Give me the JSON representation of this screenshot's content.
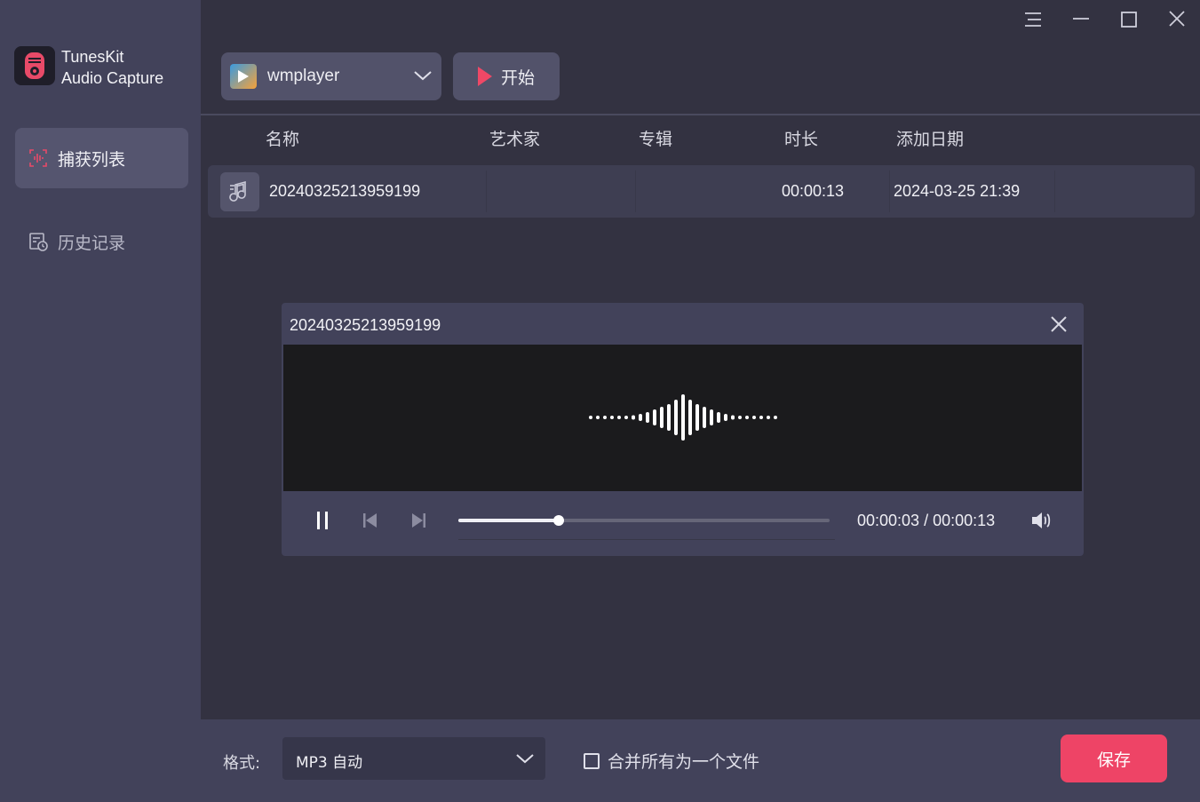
{
  "app": {
    "name_line1": "TunesKit",
    "name_line2": "Audio Capture"
  },
  "sidebar": {
    "items": [
      {
        "label": "捕获列表",
        "active": true,
        "icon": "waveform-icon"
      },
      {
        "label": "历史记录",
        "active": false,
        "icon": "history-icon"
      }
    ]
  },
  "window_controls": [
    "menu-icon",
    "minimize-icon",
    "maximize-icon",
    "close-icon"
  ],
  "toolbar": {
    "source": "wmplayer",
    "start_label": "开始"
  },
  "table": {
    "headers": {
      "name": "名称",
      "artist": "艺术家",
      "album": "专辑",
      "duration": "时长",
      "date_added": "添加日期"
    },
    "rows": [
      {
        "name": "20240325213959199",
        "artist": "",
        "album": "",
        "duration": "00:00:13",
        "date_added": "2024-03-25 21:39"
      }
    ]
  },
  "player": {
    "title": "20240325213959199",
    "current_time": "00:00:03",
    "total_time": "00:00:13",
    "time_display": "00:00:03 / 00:00:13",
    "progress": 0.27
  },
  "footer": {
    "format_label": "格式:",
    "format_value": "MP3 自动",
    "merge_label": "合并所有为一个文件",
    "merge_checked": false,
    "save_label": "保存"
  },
  "colors": {
    "accent": "#ee4466",
    "sidebar_bg": "#42425a",
    "main_bg": "#333241",
    "visualizer_bg": "#1b1b1d"
  }
}
